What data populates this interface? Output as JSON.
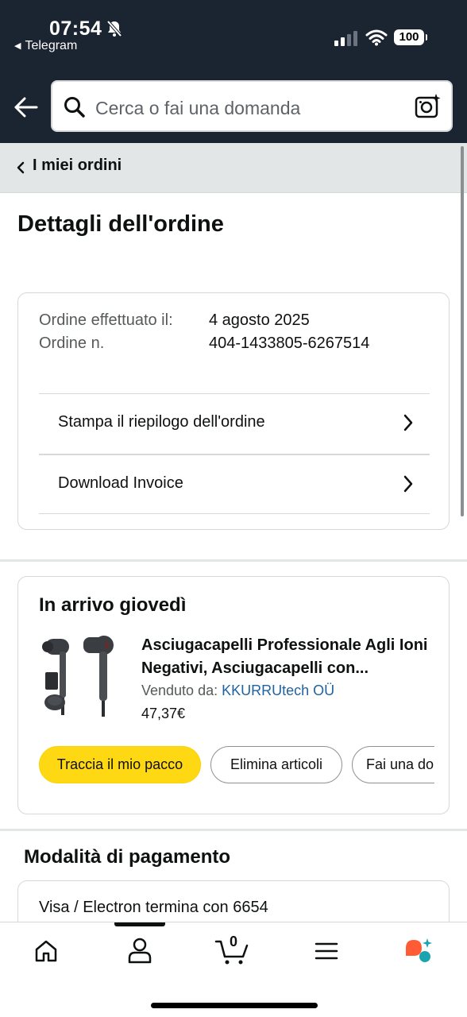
{
  "status_bar": {
    "time": "07:54",
    "back_app": "Telegram",
    "battery": "100"
  },
  "search": {
    "placeholder": "Cerca o fai una domanda"
  },
  "breadcrumb": {
    "label": "I miei ordini"
  },
  "page": {
    "title": "Dettagli dell'ordine"
  },
  "order": {
    "date_label": "Ordine effettuato il:",
    "date_value": "4 agosto 2025",
    "number_label": "Ordine n.",
    "number_value": "404-1433805-6267514",
    "links": [
      {
        "label": "Stampa il riepilogo dell'ordine"
      },
      {
        "label": "Download Invoice"
      }
    ]
  },
  "delivery": {
    "title": "In arrivo giovedì",
    "product": {
      "title": "Asciugacapelli Professionale Agli Ioni Negativi, Asciugacapelli con...",
      "seller_label": "Venduto da:",
      "seller_name": "KKURRUtech OÜ",
      "price": "47,37€"
    },
    "buttons": {
      "track": "Traccia il mio pacco",
      "remove": "Elimina articoli",
      "ask": "Fai una do"
    }
  },
  "payment": {
    "title": "Modalità di pagamento",
    "method": "Visa / Electron",
    "ending": "termina con 6654"
  },
  "bottom_nav": {
    "cart_count": "0",
    "active": "account"
  },
  "colors": {
    "header_bg": "#1b2431",
    "primary_button": "#ffd814",
    "link": "#2162a1",
    "breadcrumb_bg": "#e3e6e6"
  }
}
